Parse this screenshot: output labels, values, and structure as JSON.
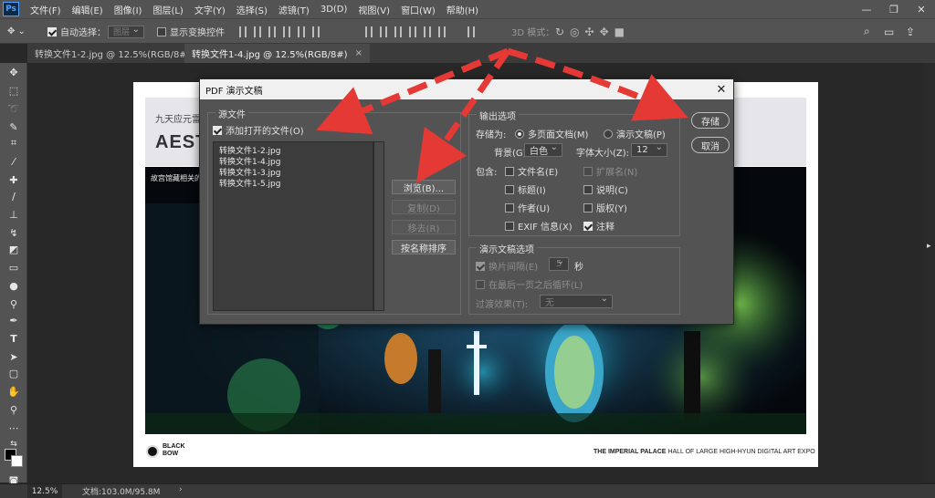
{
  "app": {
    "logo": "Ps"
  },
  "menu": [
    "文件(F)",
    "编辑(E)",
    "图像(I)",
    "图层(L)",
    "文字(Y)",
    "选择(S)",
    "滤镜(T)",
    "3D(D)",
    "视图(V)",
    "窗口(W)",
    "帮助(H)"
  ],
  "options": {
    "auto_select": "自动选择：",
    "auto_select_target": "图层",
    "show_transform": "显示变换控件",
    "mode_3d": "3D 模式："
  },
  "tabs": [
    {
      "label": "转换文件1-2.jpg @ 12.5%(RGB/8#)",
      "close": "×"
    },
    {
      "label": "转换文件1-4.jpg @ 12.5%(RGB/8#)",
      "close": "×"
    }
  ],
  "status": {
    "zoom": "12.5%",
    "doc": "文档:103.0M/95.8M"
  },
  "canvas": {
    "banner_line1": "九天应元雷",
    "banner_line2": "AESTH",
    "caption": "故宫馆藏相关的",
    "brand": "BLACK BOW",
    "footer_bold": "THE IMPERIAL PALACE",
    "footer_rest": " HALL OF LARGE HIGH-HYUN DIGITAL ART EXPO"
  },
  "dialog": {
    "title": "PDF 演示文稿",
    "close": "✕",
    "source": {
      "group_label": "源文件",
      "add_open": "添加打开的文件(O)",
      "files": [
        "转换文件1-2.jpg",
        "转换文件1-4.jpg",
        "转换文件1-3.jpg",
        "转换文件1-5.jpg"
      ],
      "browse": "浏览(B)...",
      "duplicate": "复制(D)",
      "remove": "移去(R)",
      "sort": "按名称排序"
    },
    "output": {
      "group_label": "输出选项",
      "save_as": "存储为:",
      "multi_page": "多页面文档(M)",
      "presentation": "演示文稿(P)",
      "background_label": "背景(G):",
      "background_value": "白色",
      "font_size_label": "字体大小(Z):",
      "font_size_value": "12",
      "include": "包含:",
      "filename": "文件名(E)",
      "extension": "扩展名(N)",
      "title": "标题(I)",
      "description": "说明(C)",
      "author": "作者(U)",
      "copyright": "版权(Y)",
      "exif": "EXIF 信息(X)",
      "notes": "注释"
    },
    "presentation": {
      "group_label": "演示文稿选项",
      "advance": "换片间隔(E)",
      "seconds_value": "5",
      "seconds": "秒",
      "loop": "在最后一页之后循环(L)",
      "transition_label": "过渡效果(T):",
      "transition_value": "无"
    },
    "save": "存储",
    "cancel": "取消"
  },
  "colors": {
    "arrow": "#e53935",
    "ui_bg": "#535353",
    "canvas_bg": "#282828"
  }
}
